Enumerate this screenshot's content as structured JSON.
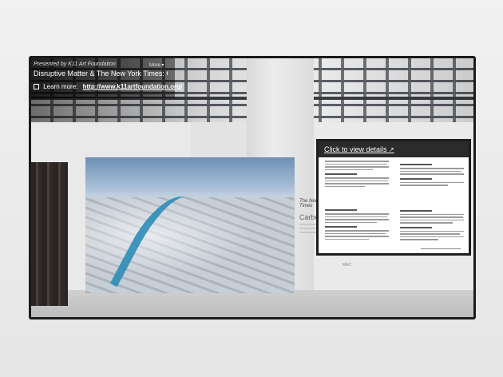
{
  "overlay": {
    "presented_by": "Presented by K11 Art Foundation",
    "more_label": "More",
    "title": "Disruptive Matter & The New York Times: C",
    "learn_more_label": "Learn more:",
    "learn_more_link": "http://www.k11artfoundation.org/"
  },
  "details_panel": {
    "link_label": "Click to view details"
  },
  "plaque": {
    "title": "The New York Times",
    "heading": "Carbo"
  },
  "logos": {
    "label": "MAC"
  },
  "icons": {
    "external_link": "external-link-icon",
    "chevron": "chevron-down-icon"
  }
}
